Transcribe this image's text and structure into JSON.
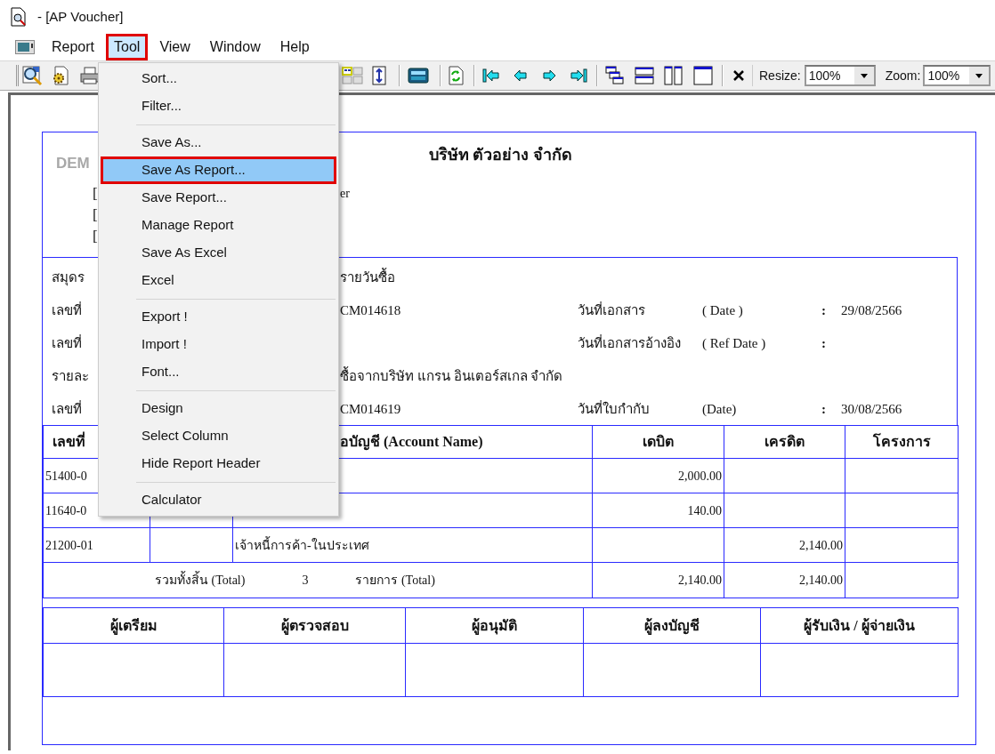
{
  "window": {
    "title": "- [AP Voucher]"
  },
  "menu_bar": [
    {
      "label": "Report",
      "selected": false
    },
    {
      "label": "Tool",
      "selected": true
    },
    {
      "label": "View",
      "selected": false
    },
    {
      "label": "Window",
      "selected": false
    },
    {
      "label": "Help",
      "selected": false
    }
  ],
  "toolbar": {
    "resize": {
      "label": "Resize:",
      "value": "100%"
    },
    "zoom": {
      "label": "Zoom:",
      "value": "100%"
    }
  },
  "report": {
    "logo_text": "DEM",
    "company": "บริษัท ตัวอย่าง จำกัด",
    "header_lines": [
      {
        "bracket": "[",
        "text": "er"
      },
      {
        "bracket": "["
      },
      {
        "bracket": "["
      }
    ],
    "info_rows": [
      {
        "label": "สมุดร",
        "value": "รายวันซื้อ"
      },
      {
        "label": "เลขที่",
        "value": "CM014618",
        "date_label": "วันที่เอกสาร",
        "date_hint": "( Date )",
        "colon": ":",
        "date": "29/08/2566"
      },
      {
        "label": "เลขที่",
        "date_label": "วันที่เอกสารอ้างอิง",
        "date_hint": "( Ref Date )",
        "colon": ":"
      },
      {
        "label": "รายละ",
        "value": "ซื้อจากบริษัท แกรน อินเตอร์สเกล จำกัด"
      },
      {
        "label": "เลขที่",
        "value": "CM014619",
        "date_label": "วันที่ใบกำกับ",
        "date_hint": "(Date)",
        "colon": ":",
        "date": "30/08/2566"
      }
    ],
    "table": {
      "columns": [
        {
          "label": "เลขที่"
        },
        {},
        {
          "label": "อบัญชี (Account Name)"
        },
        {
          "label": "เดบิต"
        },
        {
          "label": "เครดิต"
        },
        {
          "label": "โครงการ"
        }
      ],
      "rows": [
        {
          "account_no": "51400-0",
          "debit": "2,000.00"
        },
        {
          "account_no": "11640-0",
          "debit": "140.00"
        },
        {
          "account_no": "21200-01",
          "account_name": "เจ้าหนี้การค้า-ในประเทศ",
          "credit": "2,140.00"
        }
      ],
      "total": {
        "label": "รวมทั้งสิ้น (Total)",
        "count": "3",
        "count_label": "รายการ (Total)",
        "debit": "2,140.00",
        "credit": "2,140.00"
      }
    },
    "signatures": [
      "ผู้เตรียม",
      "ผู้ตรวจสอบ",
      "ผู้อนุมัติ",
      "ผู้ลงบัญชี",
      "ผู้รับเงิน / ผู้จ่ายเงิน"
    ]
  },
  "tool_menu": [
    {
      "kind": "item",
      "label": "Sort...",
      "selected": false
    },
    {
      "kind": "item",
      "label": "Filter...",
      "selected": false
    },
    {
      "kind": "separator"
    },
    {
      "kind": "item",
      "label": "Save As...",
      "selected": false
    },
    {
      "kind": "item",
      "label": "Save As Report...",
      "selected": true
    },
    {
      "kind": "item",
      "label": "Save Report...",
      "selected": false
    },
    {
      "kind": "item",
      "label": "Manage Report",
      "selected": false
    },
    {
      "kind": "item",
      "label": "Save As Excel",
      "selected": false
    },
    {
      "kind": "item",
      "label": "Excel",
      "selected": false
    },
    {
      "kind": "separator"
    },
    {
      "kind": "item",
      "label": "Export !",
      "selected": false
    },
    {
      "kind": "item",
      "label": "Import !",
      "selected": false
    },
    {
      "kind": "item",
      "label": "Font...",
      "selected": false
    },
    {
      "kind": "separator"
    },
    {
      "kind": "item",
      "label": "Design",
      "selected": false
    },
    {
      "kind": "item",
      "label": "Select Column",
      "selected": false
    },
    {
      "kind": "item",
      "label": "Hide Report Header",
      "selected": false
    },
    {
      "kind": "separator"
    },
    {
      "kind": "item",
      "label": "Calculator",
      "selected": false
    }
  ]
}
